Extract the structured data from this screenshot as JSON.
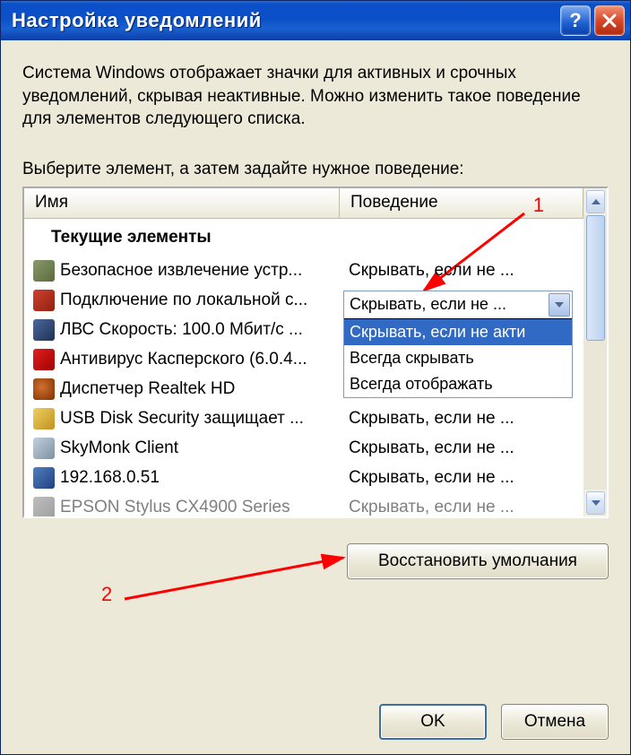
{
  "window": {
    "title": "Настройка уведомлений"
  },
  "description": "Система Windows отображает значки для активных и срочных уведомлений, скрывая неактивные. Можно изменить такое поведение для элементов следующего списка.",
  "instruction": "Выберите элемент, а затем задайте нужное поведение:",
  "columns": {
    "name": "Имя",
    "behavior": "Поведение"
  },
  "section_current": "Текущие элементы",
  "restore_button": "Восстановить умолчания",
  "ok_button": "OK",
  "cancel_button": "Отмена",
  "annotations": {
    "label1": "1",
    "label2": "2"
  },
  "items": [
    {
      "icon": "safely-remove-icon",
      "name": "Безопасное извлечение устр...",
      "behavior": "Скрывать, если не ..."
    },
    {
      "icon": "lan-connection-icon",
      "name": "Подключение по локальной с...",
      "behavior": "Скрывать, если не ..."
    },
    {
      "icon": "lan-speed-icon",
      "name": "ЛВС Скорость: 100.0 Мбит/с ...",
      "behavior": ""
    },
    {
      "icon": "kaspersky-icon",
      "name": "Антивирус Касперского (6.0.4...",
      "behavior": ""
    },
    {
      "icon": "realtek-hd-icon",
      "name": "Диспетчер Realtek HD",
      "behavior": "Скрывать, если не ..."
    },
    {
      "icon": "usb-security-icon",
      "name": "USB Disk Security защищает ...",
      "behavior": "Скрывать, если не ..."
    },
    {
      "icon": "skymonk-icon",
      "name": "SkyMonk Client",
      "behavior": "Скрывать, если не ..."
    },
    {
      "icon": "network-pc-icon",
      "name": "192.168.0.51",
      "behavior": "Скрывать, если не ..."
    },
    {
      "icon": "epson-printer-icon",
      "name": "EPSON Stylus CX4900 Series",
      "behavior": "Скрывать, если не ..."
    }
  ],
  "dropdown": {
    "selected": "Скрывать, если не ...",
    "options": [
      "Скрывать, если не акти",
      "Всегда скрывать",
      "Всегда отображать"
    ],
    "highlighted_index": 0
  }
}
